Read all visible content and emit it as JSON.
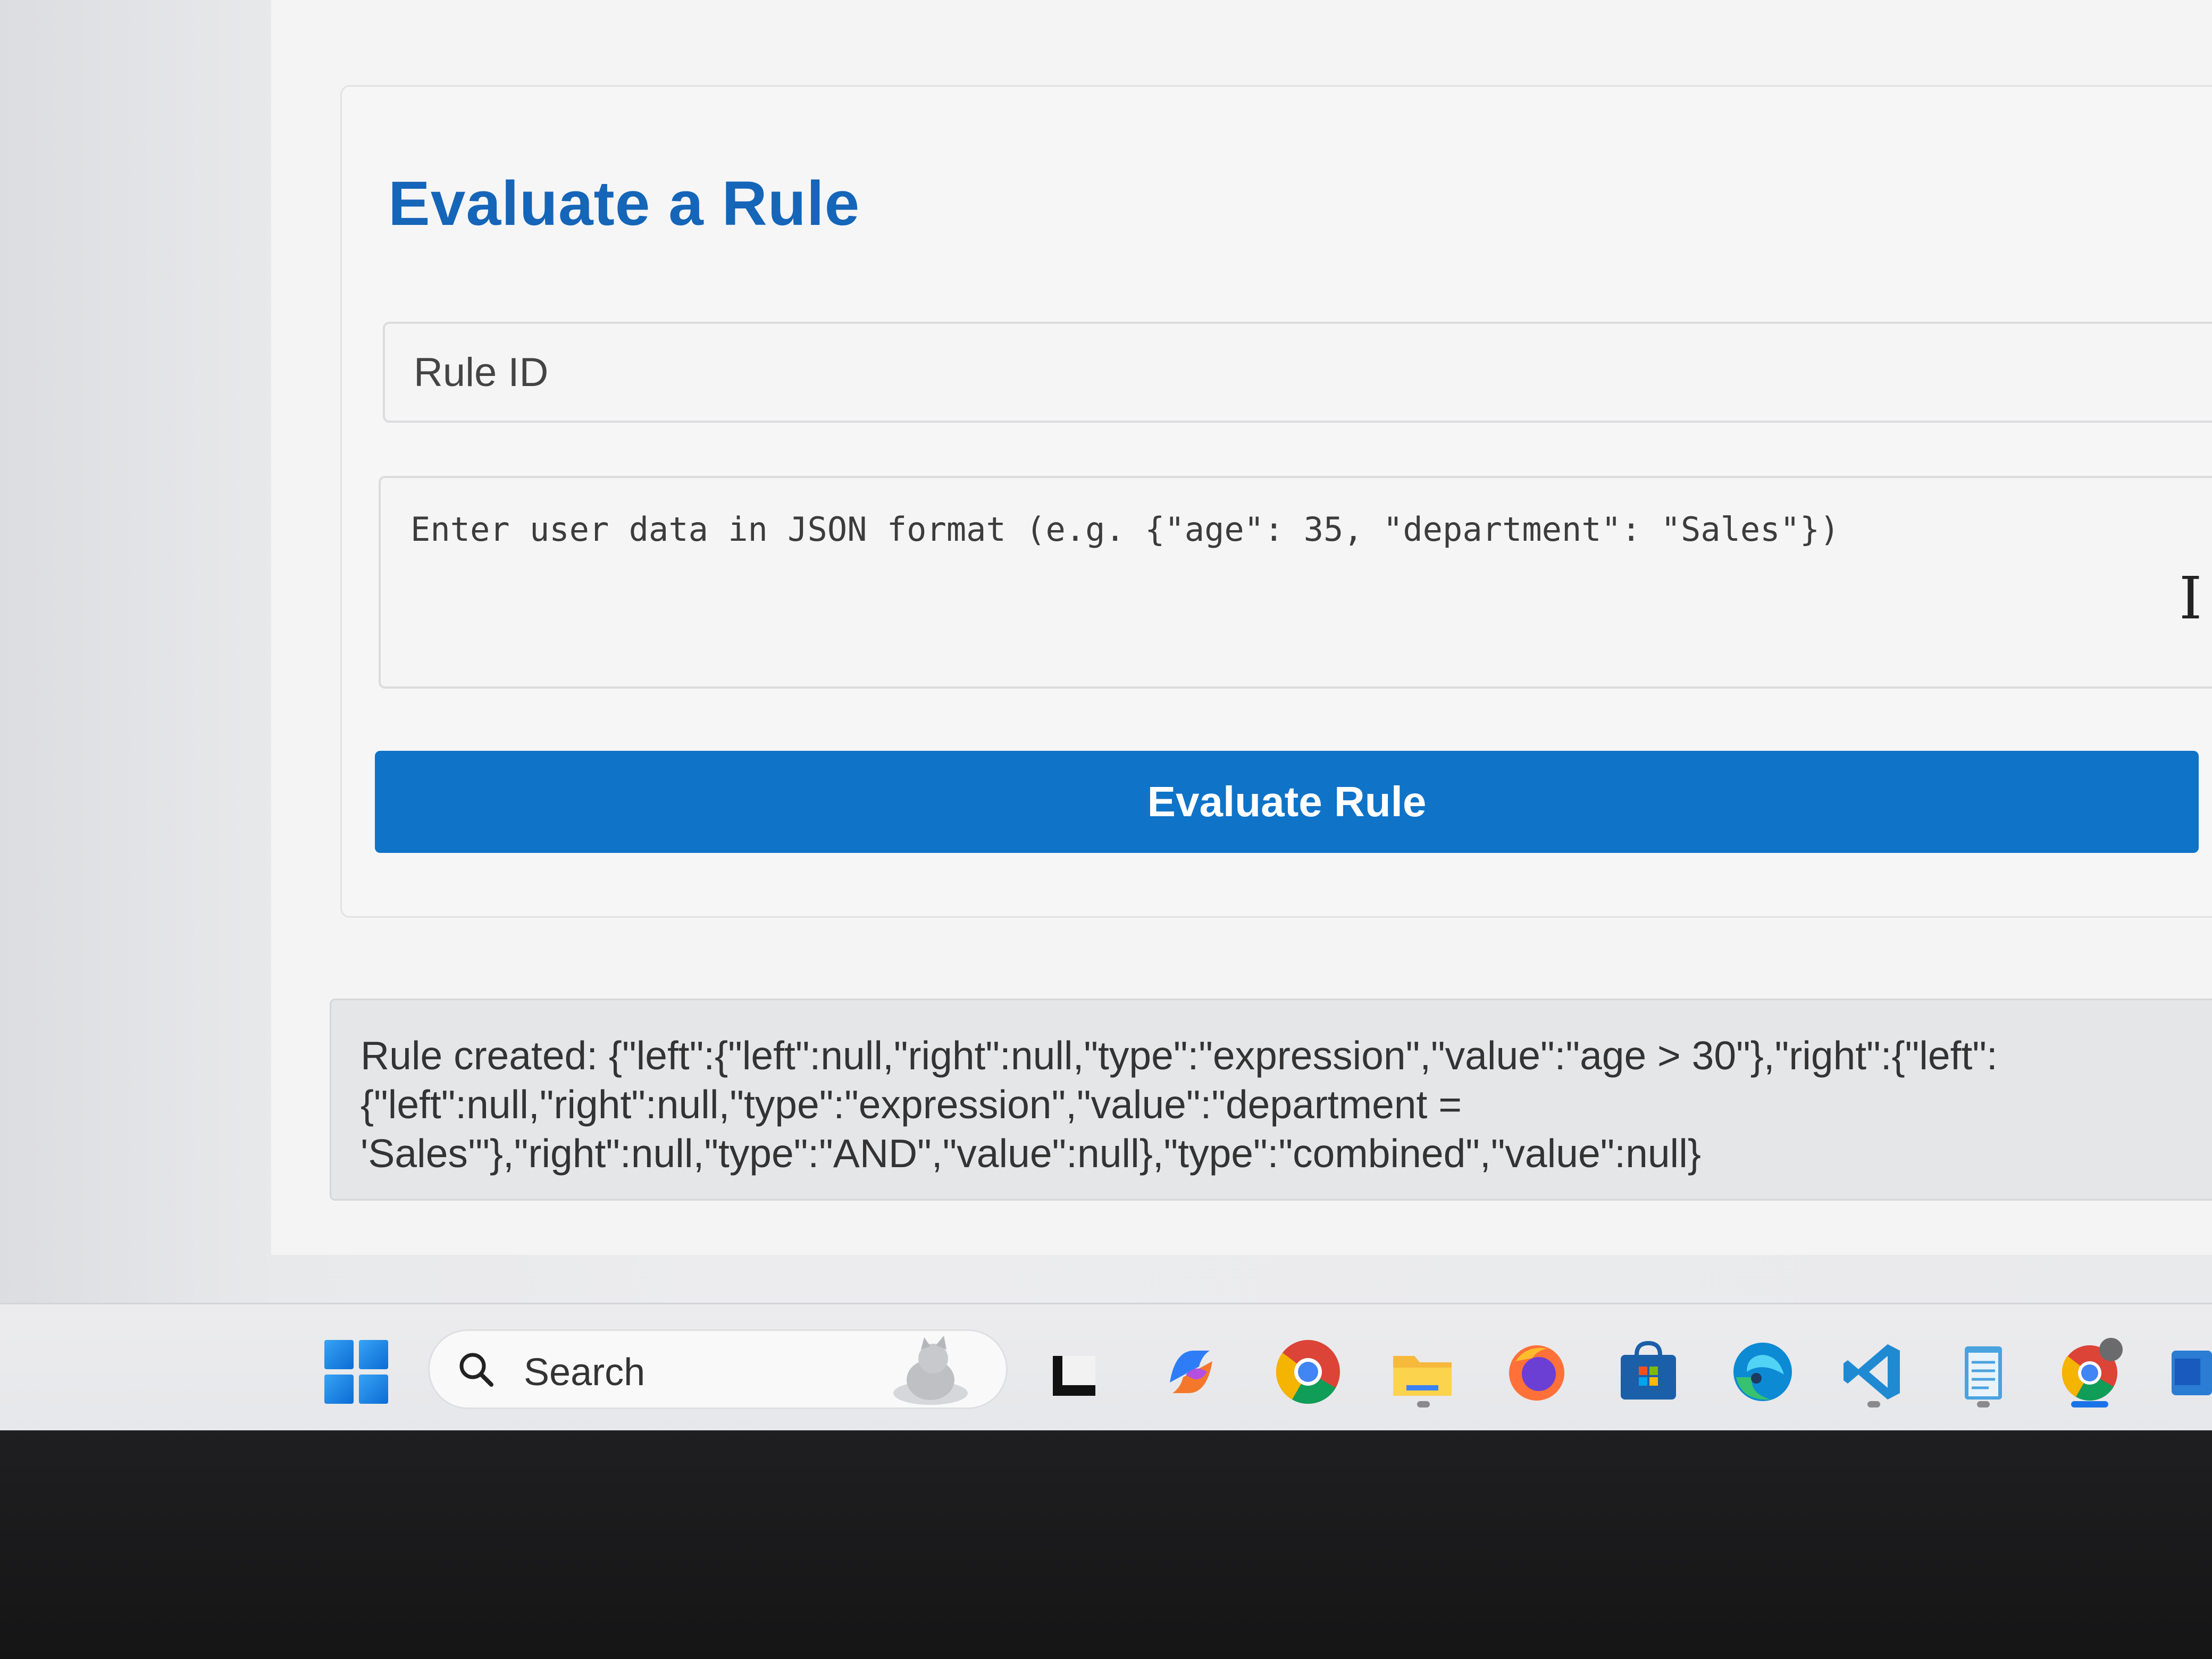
{
  "form": {
    "title": "Evaluate a Rule",
    "rule_id_placeholder": "Rule ID",
    "user_data_placeholder": "Enter user data in JSON format (e.g. {\"age\": 35, \"department\": \"Sales\"})",
    "submit_label": "Evaluate Rule",
    "accent_color": "#0f73c8"
  },
  "result": {
    "lines": [
      "Rule created: {\"left\":{\"left\":null,\"right\":null,\"type\":\"expression\",\"value\":\"age > 30\"},\"right\":{\"left\":",
      "{\"left\":null,\"right\":null,\"type\":\"expression\",\"value\":\"department =",
      "'Sales'\"},\"right\":null,\"type\":\"AND\",\"value\":null},\"type\":\"combined\",\"value\":null}"
    ]
  },
  "taskbar": {
    "search_label": "Search",
    "icons": [
      "windows-start-icon",
      "task-view-icon",
      "copilot-icon",
      "chrome-icon",
      "file-explorer-icon",
      "firefox-icon",
      "microsoft-store-icon",
      "edge-icon",
      "vscode-icon",
      "notepad-icon",
      "chrome-profile-icon",
      "word-icon"
    ]
  }
}
